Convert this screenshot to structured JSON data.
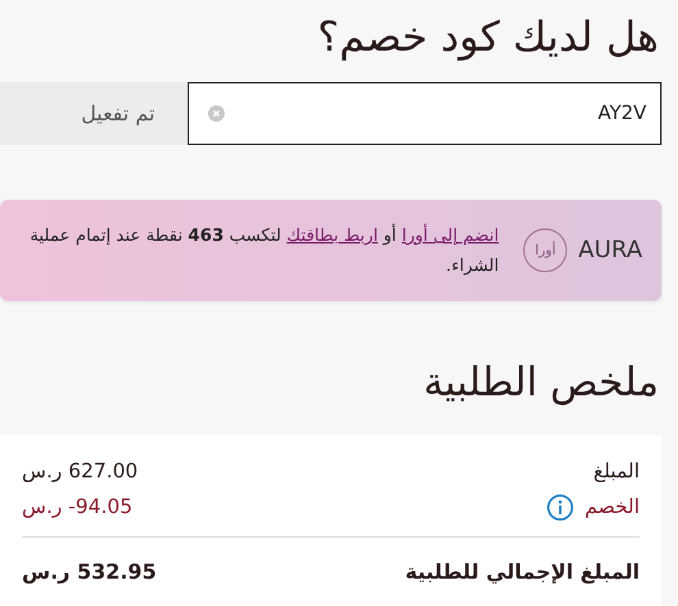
{
  "coupon": {
    "title": "هل لديك كود خصم؟",
    "value": "AY2V",
    "button": "تم تفعيل"
  },
  "aura_banner": {
    "brand": "AURA",
    "logo_text": "أورا",
    "link_join": "انضم إلى أورا",
    "connector": "أو",
    "link_card": "اربط بطاقتك",
    "message": "لتكسب **463** نقطة عند إتمام عملية الشراء."
  },
  "summary": {
    "title": "ملخص الطلبية",
    "rows": [
      {
        "kind": "amount",
        "label": "المبلغ",
        "amount": "627.00",
        "currency": "ر.س"
      },
      {
        "kind": "discount",
        "label": "الخصم",
        "amount": "-94.05",
        "currency": "ر.س"
      },
      {
        "kind": "total",
        "label": "المبلغ الإجمالي للطلبية",
        "amount": "532.95",
        "currency": "ر.س"
      }
    ]
  }
}
